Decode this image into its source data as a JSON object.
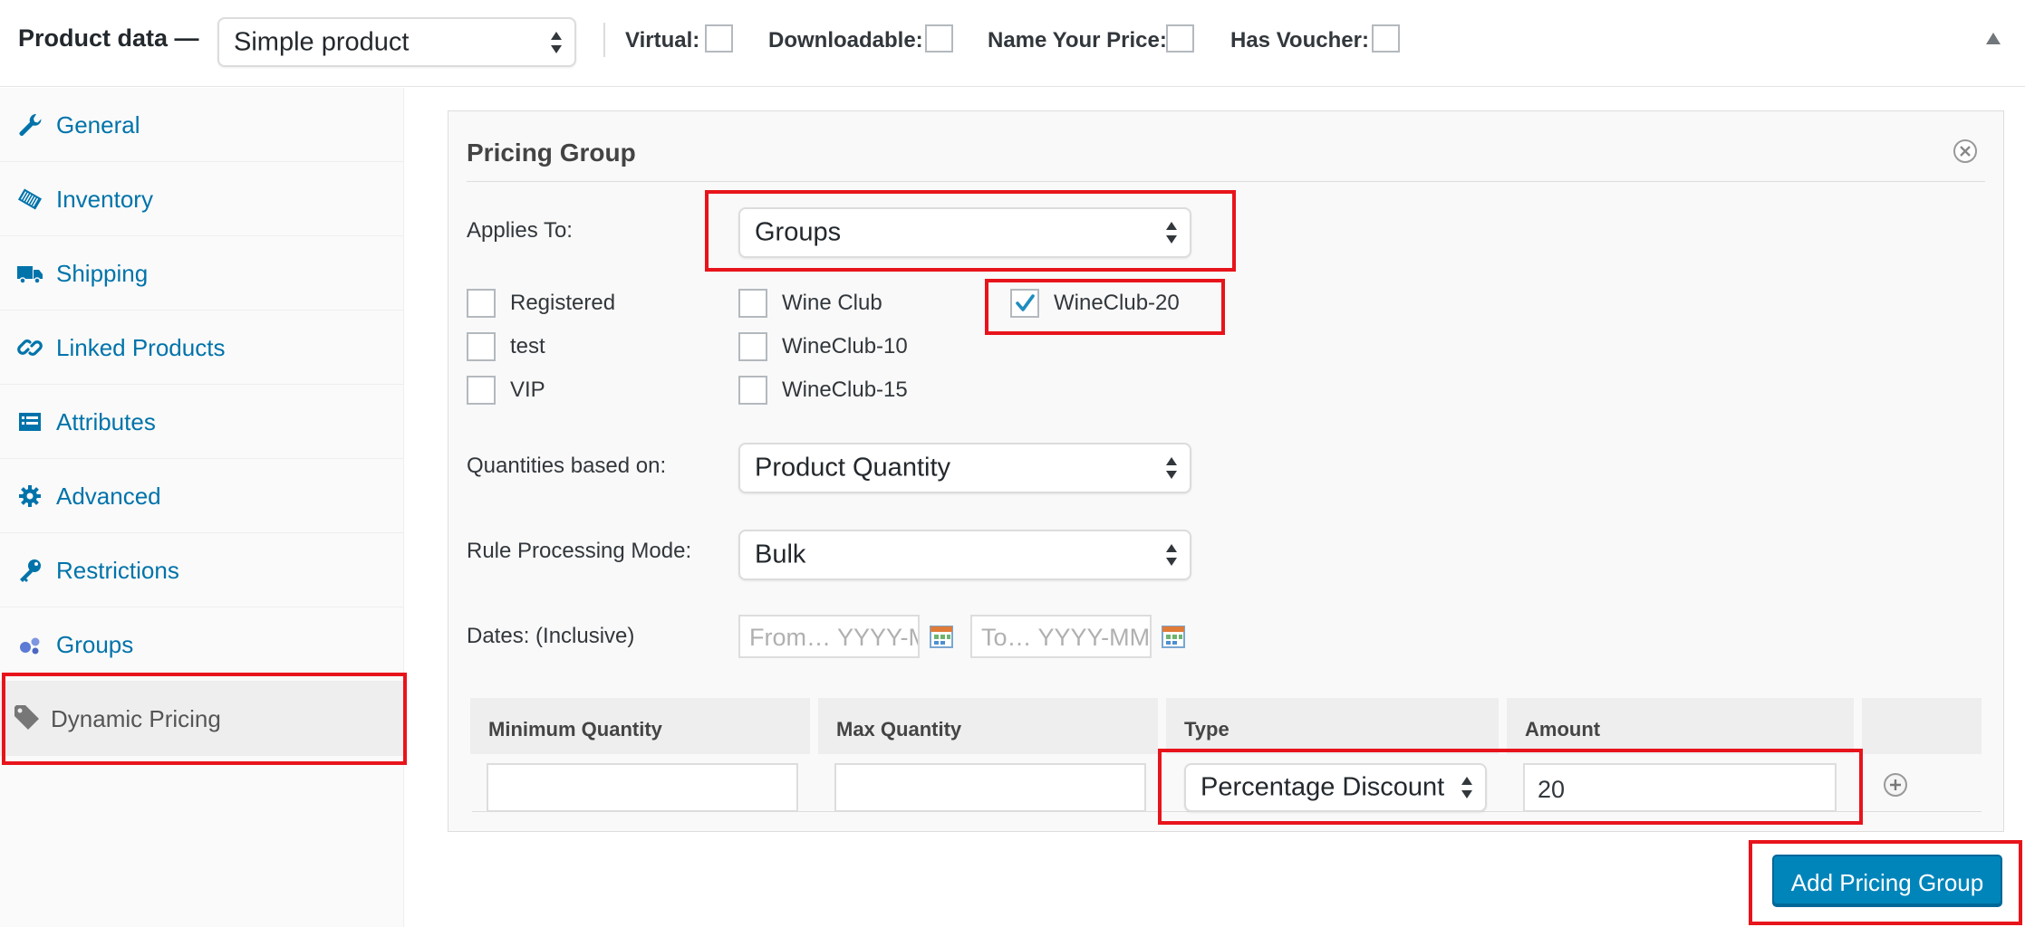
{
  "header": {
    "title": "Product data —",
    "product_type": "Simple product",
    "options": [
      {
        "label": "Virtual:",
        "checked": false
      },
      {
        "label": "Downloadable:",
        "checked": false
      },
      {
        "label": "Name Your Price:",
        "checked": false
      },
      {
        "label": "Has Voucher:",
        "checked": false
      }
    ]
  },
  "sidebar": {
    "items": [
      {
        "label": "General",
        "icon": "wrench-icon"
      },
      {
        "label": "Inventory",
        "icon": "tag-icon"
      },
      {
        "label": "Shipping",
        "icon": "truck-icon"
      },
      {
        "label": "Linked Products",
        "icon": "link-icon"
      },
      {
        "label": "Attributes",
        "icon": "list-icon"
      },
      {
        "label": "Advanced",
        "icon": "gear-icon"
      },
      {
        "label": "Restrictions",
        "icon": "key-icon"
      },
      {
        "label": "Groups",
        "icon": "groups-icon"
      },
      {
        "label": "Dynamic Pricing",
        "icon": "price-tag-icon",
        "active": true
      }
    ]
  },
  "panel": {
    "title": "Pricing Group",
    "applies_to_label": "Applies To:",
    "applies_to_value": "Groups",
    "groups": [
      {
        "label": "Registered",
        "checked": false
      },
      {
        "label": "test",
        "checked": false
      },
      {
        "label": "VIP",
        "checked": false
      },
      {
        "label": "Wine Club",
        "checked": false
      },
      {
        "label": "WineClub-10",
        "checked": false
      },
      {
        "label": "WineClub-15",
        "checked": false
      },
      {
        "label": "WineClub-20",
        "checked": true
      }
    ],
    "quantities_label": "Quantities based on:",
    "quantities_value": "Product Quantity",
    "mode_label": "Rule Processing Mode:",
    "mode_value": "Bulk",
    "dates_label": "Dates: (Inclusive)",
    "date_from_placeholder": "From… YYYY-MM-DD",
    "date_to_placeholder": "To… YYYY-MM-DD",
    "table": {
      "headers": [
        "Minimum Quantity",
        "Max Quantity",
        "Type",
        "Amount"
      ],
      "row": {
        "min": "",
        "max": "",
        "type": "Percentage Discount",
        "amount": "20"
      }
    }
  },
  "actions": {
    "add_group": "Add Pricing Group"
  },
  "colors": {
    "link": "#0073aa",
    "primary": "#0085ba",
    "highlight": "#e8141b"
  }
}
